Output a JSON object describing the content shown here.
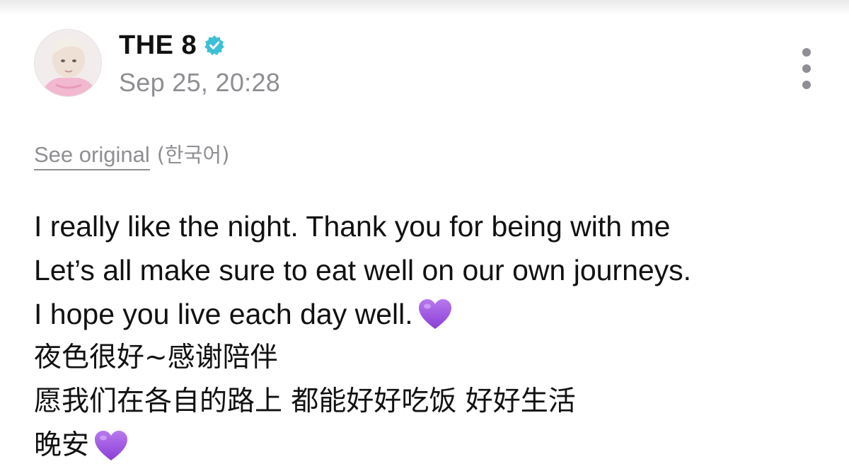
{
  "author": {
    "name": "THE 8",
    "verified": true,
    "avatar": "avatar-photo"
  },
  "post": {
    "timestamp": "Sep 25, 20:28",
    "translation": {
      "see_original_label": "See original",
      "original_language": "(한국어)"
    },
    "lines": [
      {
        "text": "I really like the night. Thank you for being with me",
        "emoji": ""
      },
      {
        "text": "Let’s all make sure to eat well on our own journeys.",
        "emoji": ""
      },
      {
        "text": "I hope you live each day well.",
        "emoji": "purple-heart-icon"
      },
      {
        "text": "夜色很好~感谢陪伴",
        "emoji": ""
      },
      {
        "text": "愿我们在各自的路上 都能好好吃饭 好好生活",
        "emoji": ""
      },
      {
        "text": "晚安",
        "emoji": "purple-heart-icon"
      }
    ]
  },
  "icons": {
    "verified": "verified-badge-icon",
    "more": "more-options-icon"
  },
  "colors": {
    "verified_badge": "#3cc0d6",
    "secondary_text": "#8e8e93",
    "heart": "#9b4ee0"
  }
}
